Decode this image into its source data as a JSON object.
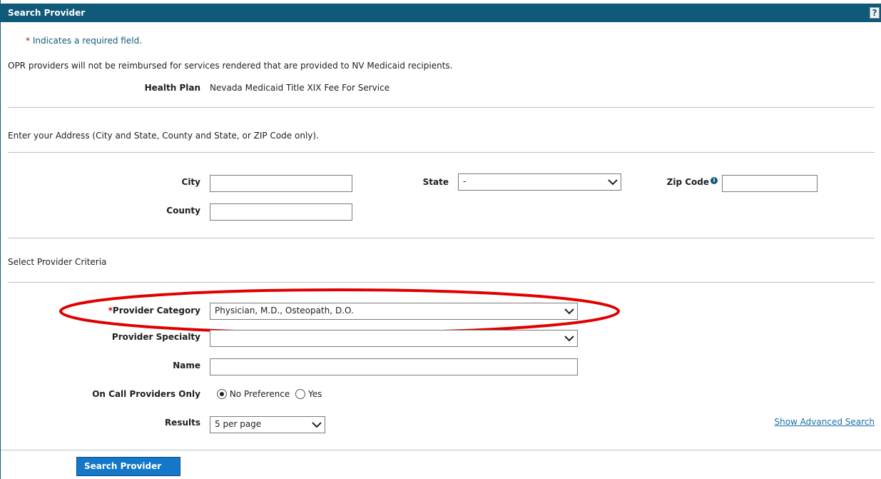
{
  "header": {
    "title": "Search Provider",
    "help": "?"
  },
  "notes": {
    "required_asterisk": "*",
    "required_text": "Indicates a required field.",
    "opr_warning": "OPR providers will not be reimbursed for services rendered that are provided to NV Medicaid recipients."
  },
  "health_plan": {
    "label": "Health Plan",
    "value": "Nevada Medicaid Title XIX Fee For Service"
  },
  "address": {
    "instruction": "Enter your Address (City and State, County and State, or ZIP Code only).",
    "city_label": "City",
    "city_value": "",
    "county_label": "County",
    "county_value": "",
    "state_label": "State",
    "state_value": "-",
    "zip_label": "Zip Code",
    "zip_value": ""
  },
  "criteria": {
    "title": "Select Provider Criteria",
    "category_label": "Provider Category",
    "category_value": "Physician, M.D., Osteopath, D.O.",
    "specialty_label": "Provider Specialty",
    "specialty_value": "",
    "name_label": "Name",
    "name_value": "",
    "oncall_label": "On Call Providers Only",
    "oncall_opt1": "No Preference",
    "oncall_opt2": "Yes",
    "results_label": "Results",
    "results_value": "5 per page",
    "advanced_link": "Show Advanced Search"
  },
  "actions": {
    "search_button": "Search Provider"
  },
  "colors": {
    "header": "#0e5a78",
    "button": "#1477c8",
    "highlight": "#e00000"
  }
}
